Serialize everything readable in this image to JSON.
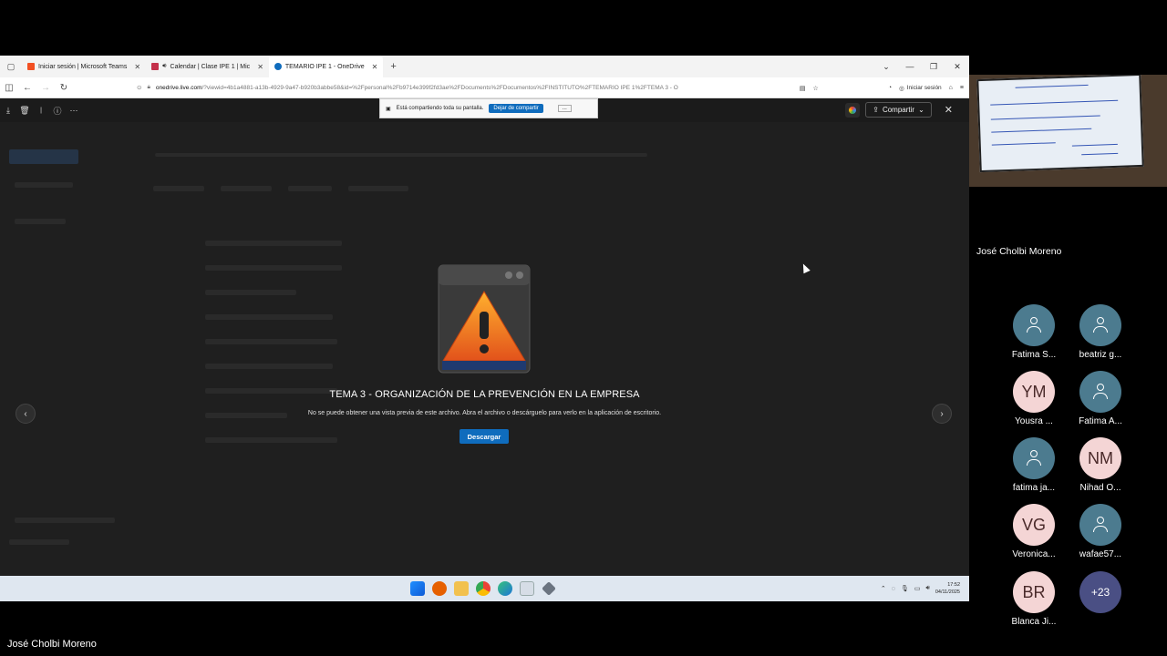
{
  "browser": {
    "tabs": [
      {
        "label": "Iniciar sesión | Microsoft Teams",
        "color": "#f25022"
      },
      {
        "label": "Calendar | Clase IPE 1 | Mic",
        "color": "#c4314b"
      },
      {
        "label": "TEMARIO IPE 1 - OneDrive",
        "color": "#0f6cbd"
      }
    ],
    "new_tab": "+",
    "url_domain": "onedrive.live.com",
    "url_rest": "/?viewid=4b1a4881-a13b-4929-9a47-b920b3abbe58&id=%2Fpersonal%2Fb9714e399f2fd3ae%2FDocuments%2FDocumentos%2FINSTITUTO%2FTEMARIO IPE 1%2FTEMA 3 - O",
    "signin_label": "Iniciar sesión"
  },
  "share_notice": {
    "text": "Está compartiendo toda su pantalla.",
    "stop_label": "Dejar de compartir",
    "minimize_label": "..."
  },
  "viewer": {
    "share_label": "Compartir",
    "close": "✕"
  },
  "preview": {
    "title": "TEMA 3 - ORGANIZACIÓN DE LA PREVENCIÓN EN LA EMPRESA",
    "message": "No se puede obtener una vista previa de este archivo. Abra el archivo o descárguelo para verlo en la aplicación de escritorio.",
    "download_label": "Descargar",
    "prev": "‹",
    "next": "›"
  },
  "taskbar": {
    "time": "17:52",
    "date": "04/11/2025"
  },
  "presenter": {
    "name": "José Cholbi Moreno"
  },
  "video": {
    "name": "José Cholbi Moreno"
  },
  "participants": [
    {
      "name": "Fatima S...",
      "initials": "",
      "type": "generic"
    },
    {
      "name": "beatriz g...",
      "initials": "",
      "type": "generic"
    },
    {
      "name": "Yousra ...",
      "initials": "YM",
      "type": "initials"
    },
    {
      "name": "Fatima A...",
      "initials": "",
      "type": "generic"
    },
    {
      "name": "fatima ja...",
      "initials": "",
      "type": "generic"
    },
    {
      "name": "Nihad O...",
      "initials": "NM",
      "type": "initials"
    },
    {
      "name": "Veronica...",
      "initials": "VG",
      "type": "initials"
    },
    {
      "name": "wafae57...",
      "initials": "",
      "type": "generic"
    },
    {
      "name": "Blanca Ji...",
      "initials": "BR",
      "type": "initials"
    },
    {
      "name": "",
      "initials": "+23",
      "type": "more"
    }
  ]
}
